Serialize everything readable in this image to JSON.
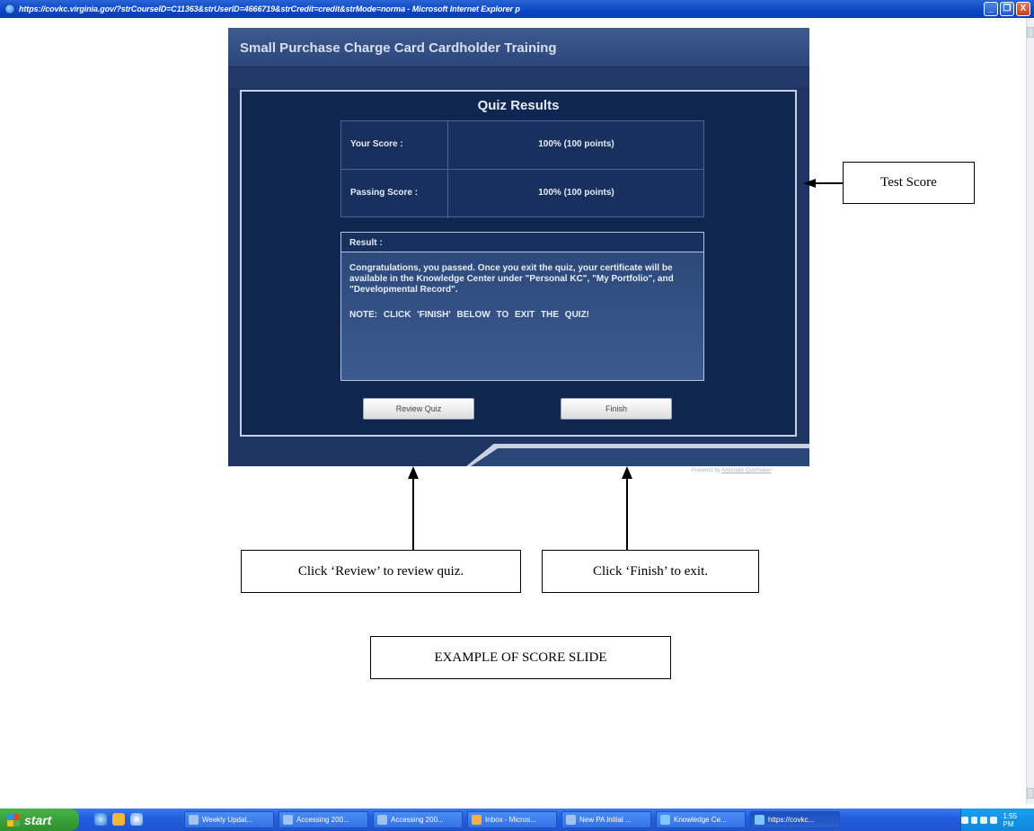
{
  "window": {
    "title": "https://covkc.virginia.gov/?strCourseID=C11363&strUserID=4666719&strCredit=credit&strMode=norma - Microsoft Internet Explorer p",
    "buttons": [
      "_",
      "❐",
      "X"
    ]
  },
  "course": {
    "title": "Small Purchase Charge Card Cardholder Training",
    "quiz_title": "Quiz Results",
    "your_score_label": "Your Score :",
    "your_score_value": "100% (100 points)",
    "passing_score_label": "Passing Score :",
    "passing_score_value": "100%  (100 points)",
    "result_label": "Result :",
    "result_message": "Congratulations, you passed.  Once you exit the quiz, your certificate will be available in the Knowledge Center under \"Personal KC\", \"My Portfolio\", and \"Developmental Record\".",
    "result_note": "NOTE:  CLICK   'FINISH'   BELOW TO EXIT THE QUIZ!",
    "review_button": "Review Quiz",
    "finish_button": "Finish",
    "powered_by": "Powered by ",
    "powered_link": "Articulate Quizmaker"
  },
  "annotations": {
    "test_score": "Test Score",
    "click_review": "Click ‘Review’ to review quiz.",
    "click_finish": "Click ‘Finish’ to exit.",
    "example": "EXAMPLE OF SCORE SLIDE"
  },
  "taskbar": {
    "start_label": "start",
    "quick_launch_icons": [
      "ie-icon",
      "outlook-icon",
      "desktop-icon"
    ],
    "tasks": [
      {
        "label": "Weekly Updat...",
        "icon": "#9fc3ef"
      },
      {
        "label": "Accessing 200...",
        "icon": "#9fc3ef"
      },
      {
        "label": "Accessing 200...",
        "icon": "#9fc3ef"
      },
      {
        "label": "Inbox - Micros...",
        "icon": "#f2b23c"
      },
      {
        "label": "New PA Initial ...",
        "icon": "#9fc3ef"
      },
      {
        "label": "Knowledge Ce...",
        "icon": "#7ec6ff"
      },
      {
        "label": "https://covkc...",
        "icon": "#7ec6ff"
      }
    ],
    "clock": "1:55 PM"
  }
}
